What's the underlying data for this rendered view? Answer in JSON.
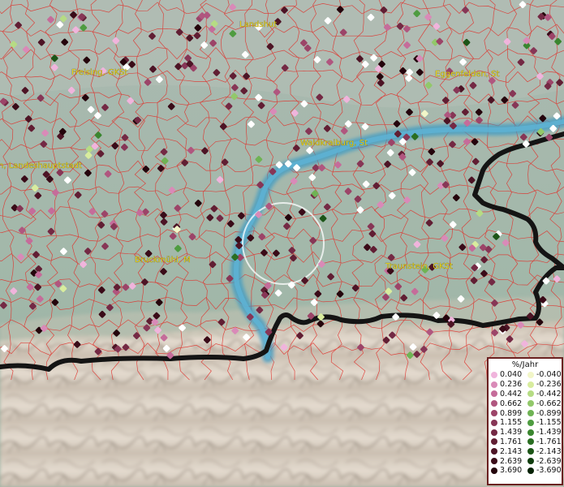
{
  "places": [
    {
      "id": "landshut",
      "label": "Landshut"
    },
    {
      "id": "freising",
      "label": "Freising, GKSt"
    },
    {
      "id": "eggenfelden",
      "label": "Eggenfelden, St"
    },
    {
      "id": "waldkraiburg",
      "label": "Waldkraiburg, St"
    },
    {
      "id": "muenchen",
      "label": "n, Landeshauptstadt"
    },
    {
      "id": "bruckmuehl",
      "label": "Bruckmühl, M"
    },
    {
      "id": "traunstein",
      "label": "Traunstein, GKSt"
    }
  ],
  "legend": {
    "title": "%/Jahr",
    "positive": [
      {
        "value": "0.040",
        "color": "#f0b4dc"
      },
      {
        "value": "0.236",
        "color": "#d98ab8"
      },
      {
        "value": "0.442",
        "color": "#c56c9a"
      },
      {
        "value": "0.662",
        "color": "#b0567f"
      },
      {
        "value": "0.899",
        "color": "#9c4468"
      },
      {
        "value": "1.155",
        "color": "#873656"
      },
      {
        "value": "1.439",
        "color": "#742944"
      },
      {
        "value": "1.761",
        "color": "#611e33"
      },
      {
        "value": "2.143",
        "color": "#4d1425"
      },
      {
        "value": "2.639",
        "color": "#3a0b18"
      },
      {
        "value": "3.690",
        "color": "#24040c"
      }
    ],
    "negative": [
      {
        "value": "-0.040",
        "color": "#f2f6c8"
      },
      {
        "value": "-0.236",
        "color": "#d8ec9e"
      },
      {
        "value": "-0.442",
        "color": "#b6dc84"
      },
      {
        "value": "-0.662",
        "color": "#92c86a"
      },
      {
        "value": "-0.899",
        "color": "#6fb354"
      },
      {
        "value": "-1.155",
        "color": "#4e9c40"
      },
      {
        "value": "-1.439",
        "color": "#3a862f"
      },
      {
        "value": "-1.761",
        "color": "#2a6e22"
      },
      {
        "value": "-2.143",
        "color": "#1c5517"
      },
      {
        "value": "-2.639",
        "color": "#103d0e"
      },
      {
        "value": "-3.690",
        "color": "#062205"
      }
    ]
  },
  "style": {
    "river_color": "#3e9bc4",
    "border_color": "#111111",
    "municipal_line_color": "#e0302a",
    "mountain_color": "#d9cdbf",
    "lowland_color": "#a4b9ad"
  }
}
